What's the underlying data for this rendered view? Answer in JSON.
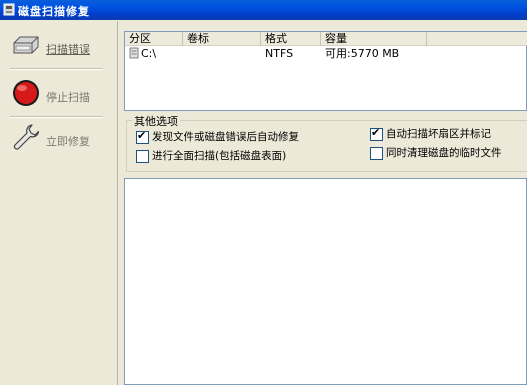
{
  "window": {
    "title": "磁盘扫描修复"
  },
  "sidebar": {
    "items": [
      {
        "label": "扫描错误",
        "icon": "hard-disk-icon"
      },
      {
        "label": "停止扫描",
        "icon": "stop-icon"
      },
      {
        "label": "立即修复",
        "icon": "wrench-icon"
      }
    ]
  },
  "disk_table": {
    "columns": [
      "分区",
      "卷标",
      "格式",
      "容量"
    ],
    "rows": [
      {
        "partition": "C:\\",
        "volume_label": "",
        "format": "NTFS",
        "capacity": "可用:5770 MB"
      }
    ]
  },
  "options": {
    "legend": "其他选项",
    "items": [
      {
        "label": "发现文件或磁盘错误后自动修复",
        "checked": true
      },
      {
        "label": "自动扫描坏扇区并标记",
        "checked": true
      },
      {
        "label": "进行全面扫描(包括磁盘表面)",
        "checked": false
      },
      {
        "label": "同时清理磁盘的临时文件",
        "checked": false
      }
    ]
  },
  "colors": {
    "title_bar": "#0054e3",
    "panel": "#ece9d8",
    "list_background": "#ffffff"
  }
}
